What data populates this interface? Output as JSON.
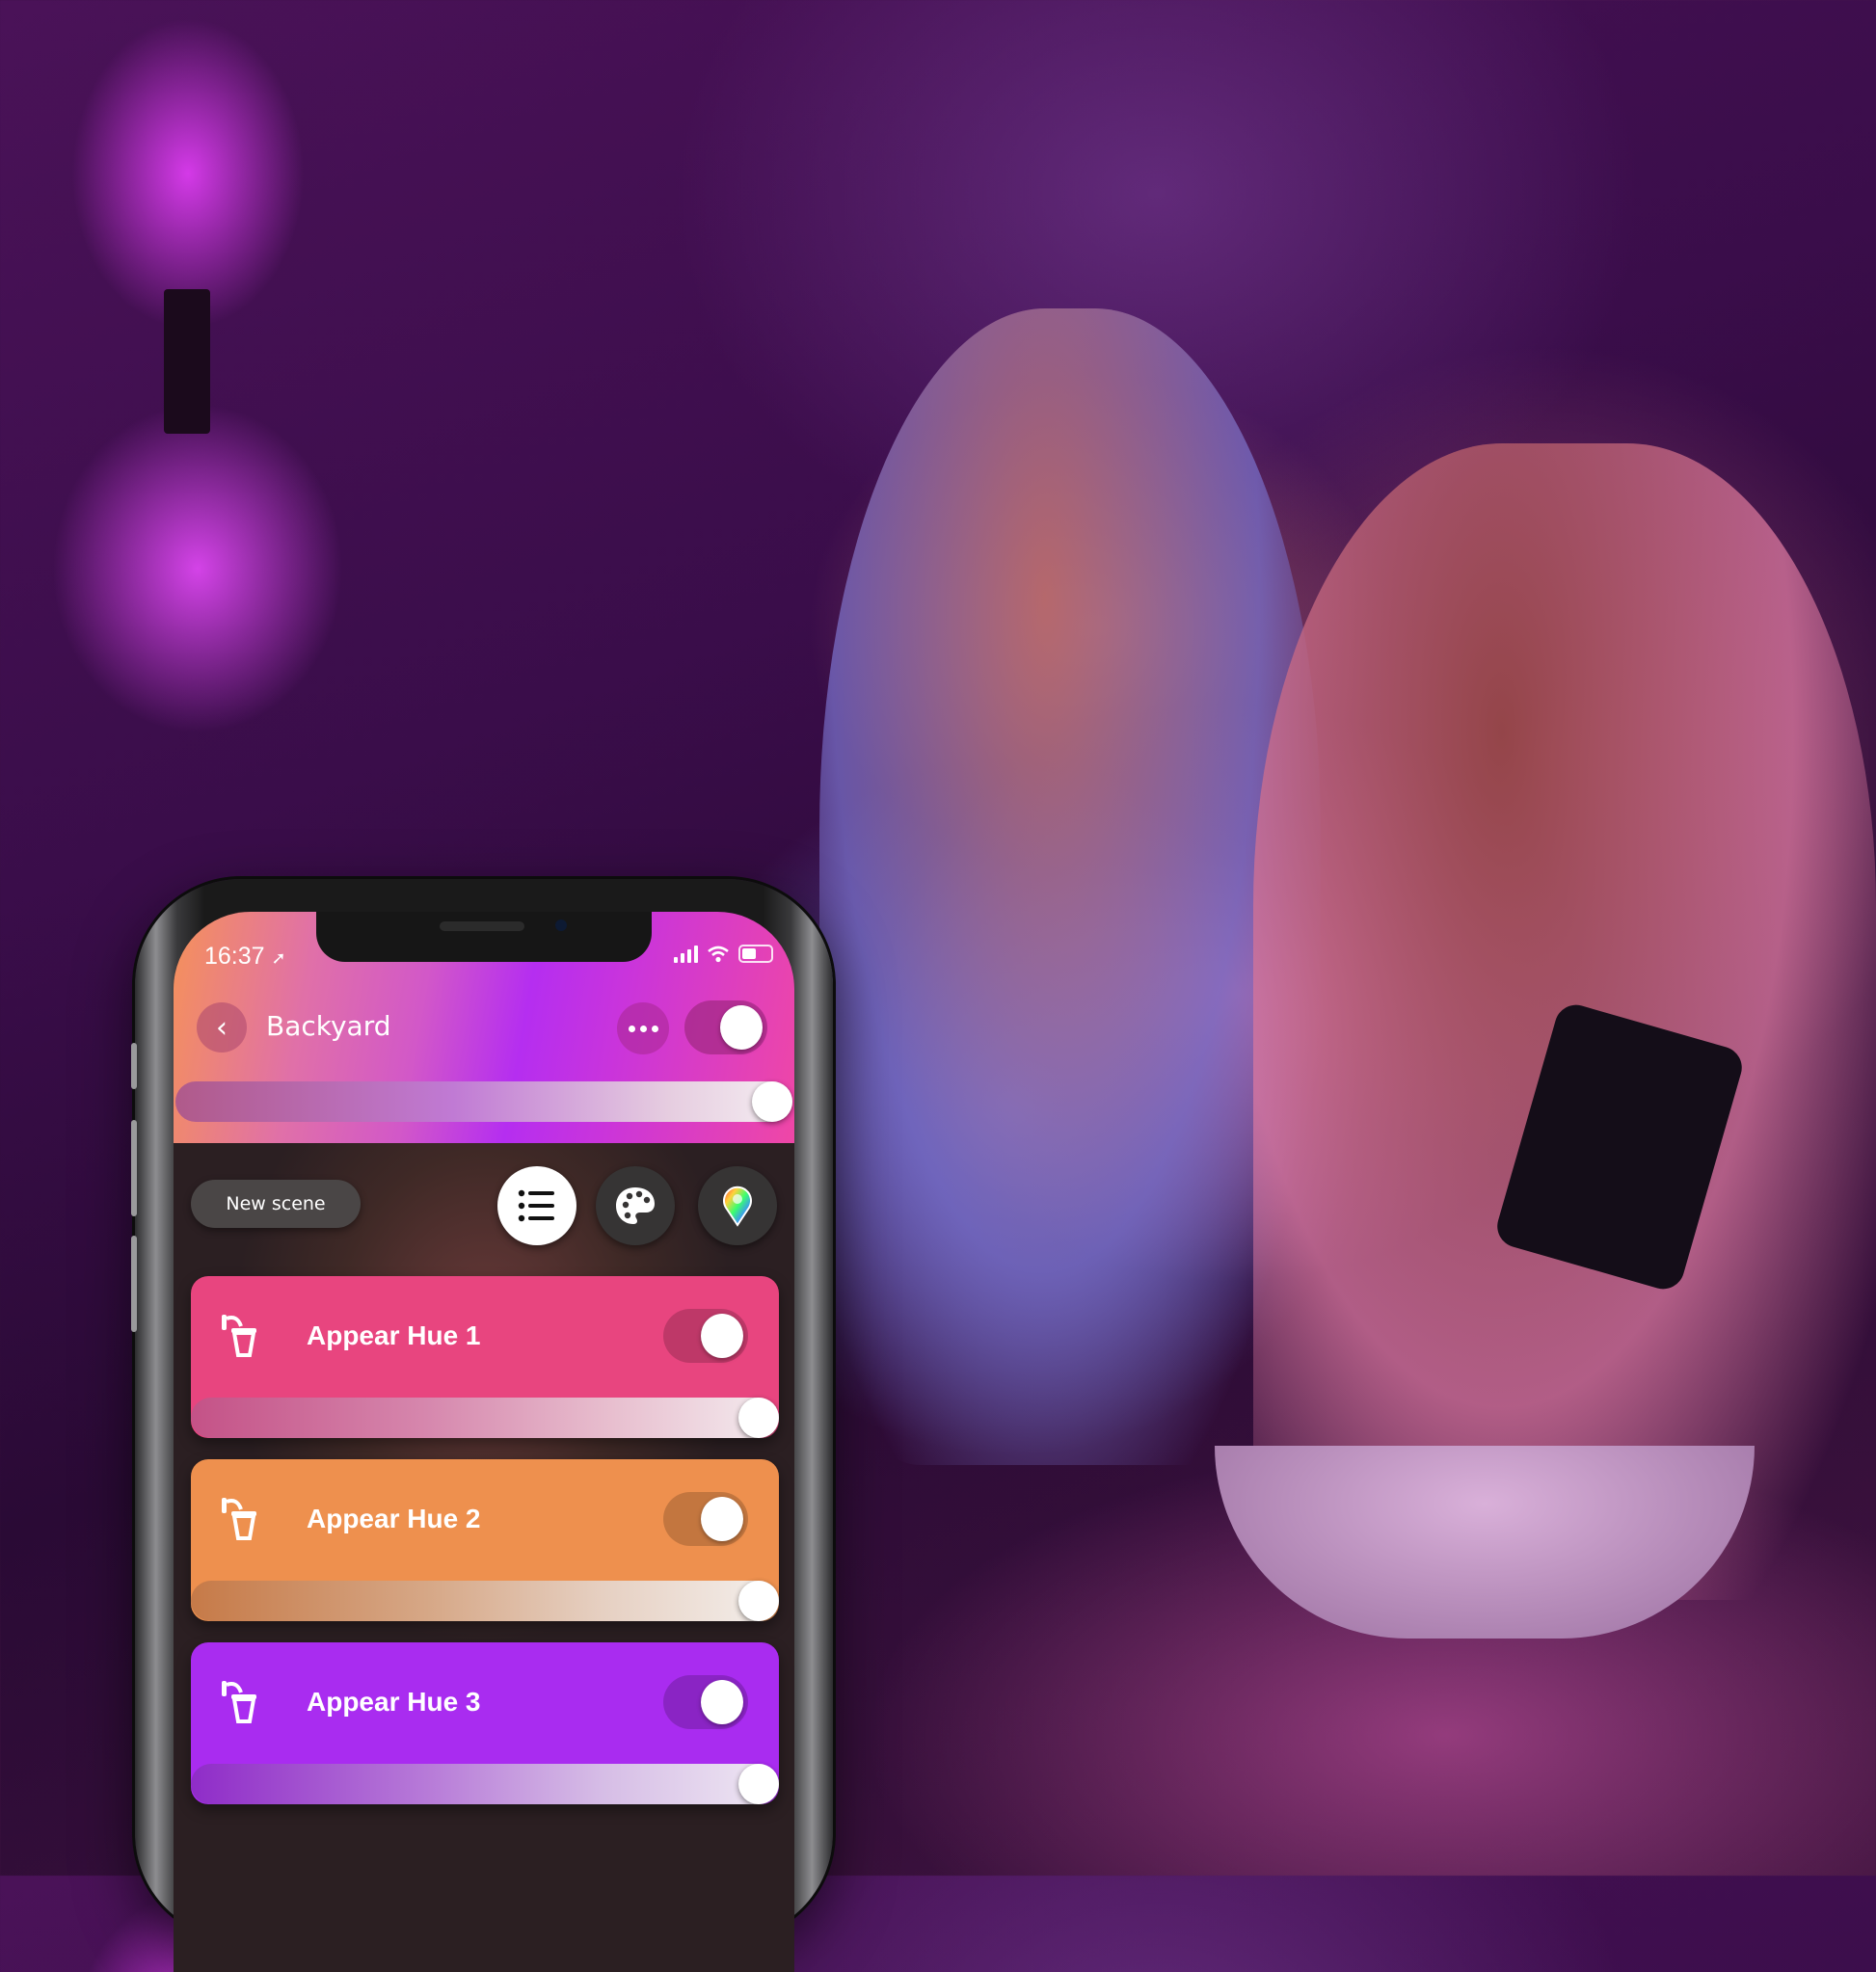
{
  "phone": {
    "status_bar": {
      "time": "16:37",
      "location_icon": "location-arrow-icon",
      "signal_icon": "cellular-signal-icon",
      "wifi_icon": "wifi-icon",
      "battery_icon": "battery-icon"
    },
    "header": {
      "back_icon": "chevron-left-icon",
      "back_glyph": "‹",
      "title": "Backyard",
      "more_icon": "more-horizontal-icon",
      "room_power_on": true,
      "brightness_percent": 100
    },
    "toolbar": {
      "new_scene_label": "New scene",
      "views": [
        {
          "name": "list-view",
          "icon": "list-icon",
          "selected": true
        },
        {
          "name": "scene-view",
          "icon": "palette-icon",
          "selected": false
        },
        {
          "name": "color-picker-view",
          "icon": "color-wheel-pin-icon",
          "selected": false
        }
      ]
    },
    "lights": [
      {
        "name": "Appear Hue 1",
        "icon": "outdoor-wall-lantern-icon",
        "color": "#e8457f",
        "on": true,
        "brightness_percent": 100
      },
      {
        "name": "Appear Hue 2",
        "icon": "outdoor-wall-lantern-icon",
        "color": "#ee904e",
        "on": true,
        "brightness_percent": 100
      },
      {
        "name": "Appear Hue 3",
        "icon": "outdoor-wall-lantern-icon",
        "color": "#a92cf0",
        "on": true,
        "brightness_percent": 100
      }
    ]
  },
  "colors": {
    "header_gradient_start": "#f5915a",
    "header_gradient_mid": "#b52ef0",
    "header_gradient_end": "#ef47a6",
    "background_ambient": "#3a0d4a"
  }
}
